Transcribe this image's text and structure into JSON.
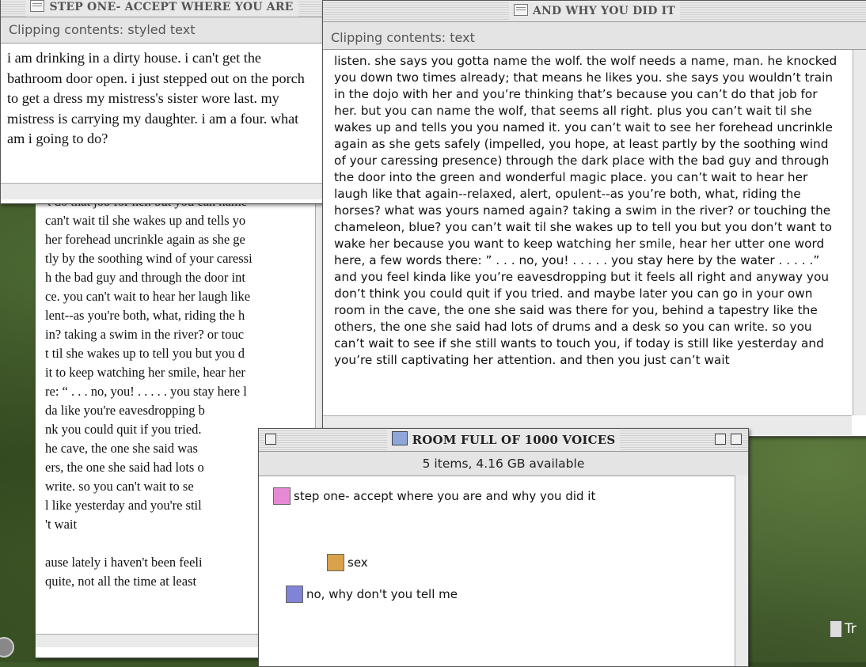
{
  "back_window": {
    "lines": [
      "'t do that job for her. but you can name",
      " can't wait til she wakes up and tells yo",
      "her forehead uncrinkle again as she ge",
      "tly by the soothing wind of your caressi",
      "h the bad guy and through the door int",
      "ce. you can't wait to hear her laugh like",
      "lent--as you're both, what, riding the h",
      "in? taking a swim in the river? or touc",
      "t til she wakes up to tell you but you d",
      "it to keep watching her smile, hear her",
      "re:  “ . . . no, you! . . . . . you stay here l",
      "da like you're eavesdropping b",
      "nk you could quit if you tried.",
      "he cave, the one she said was",
      "ers, the one she said had lots o",
      " write. so you can't wait to se",
      "l like yesterday and you're stil",
      "'t wait",
      "",
      "ause lately i haven't been feeli",
      " quite, not all the time at least"
    ]
  },
  "step_window": {
    "title": "STEP ONE- ACCEPT WHERE YOU ARE",
    "info": "Clipping contents: styled text",
    "text": "i am drinking in a dirty house. i can't get the bathroom door open. i just stepped out on the porch to get a dress my mistress's sister wore last. my mistress is carrying my daughter. i am a four. what am i going to do?"
  },
  "why_window": {
    "title": "AND WHY YOU DID IT",
    "info": "Clipping contents: text",
    "text": "listen. she says you gotta name the wolf. the wolf needs a name, man. he knocked you down two times already; that means he likes you. she says you wouldn’t train in the dojo with her and you’re thinking that’s because you can’t do that job for her. but you can name the wolf, that seems all right. plus you can’t wait til she wakes up and tells you you named it. you can’t wait to see her forehead uncrinkle again as she gets safely (impelled, you hope, at least partly by the soothing wind of your caressing presence) through the dark place with the bad guy and through the door into the green and wonderful magic place. you can’t wait to hear her laugh like that again--relaxed, alert, opulent--as you’re both, what, riding the horses? what was yours named again? taking a swim in the river? or touching the chameleon, blue? you can’t wait til she wakes up to tell you but you don’t want to wake her because you want to keep watching her smile, hear her utter one word here, a few words there:  ” . . . no, you! . . . . . you stay here by the water . . . . .” and you feel kinda like you’re eavesdropping but it feels all right and anyway you don’t think you could quit if you tried. and maybe later you can go in your own room in the cave, the one she said was there for you, behind a tapestry like the others, the one she said had lots of drums and a desk so you can write. so you can’t wait to see if she still wants to touch you, if today is still like yesterday and you’re still captivating her attention. and then you just can’t wait"
  },
  "room_window": {
    "title": "ROOM FULL OF 1000 VOICES",
    "info": "5 items, 4.16 GB available",
    "items": [
      {
        "label": "step one- accept where you are and why you did it",
        "icon": "pink-clipping-icon",
        "color": "#e68ad6"
      },
      {
        "label": "sex",
        "icon": "orange-clipping-icon",
        "color": "#d9a24a"
      },
      {
        "label": "no, why don't you tell me",
        "icon": "blue-alias-icon",
        "color": "#7f84d6"
      }
    ]
  },
  "trash_label": "Tr"
}
